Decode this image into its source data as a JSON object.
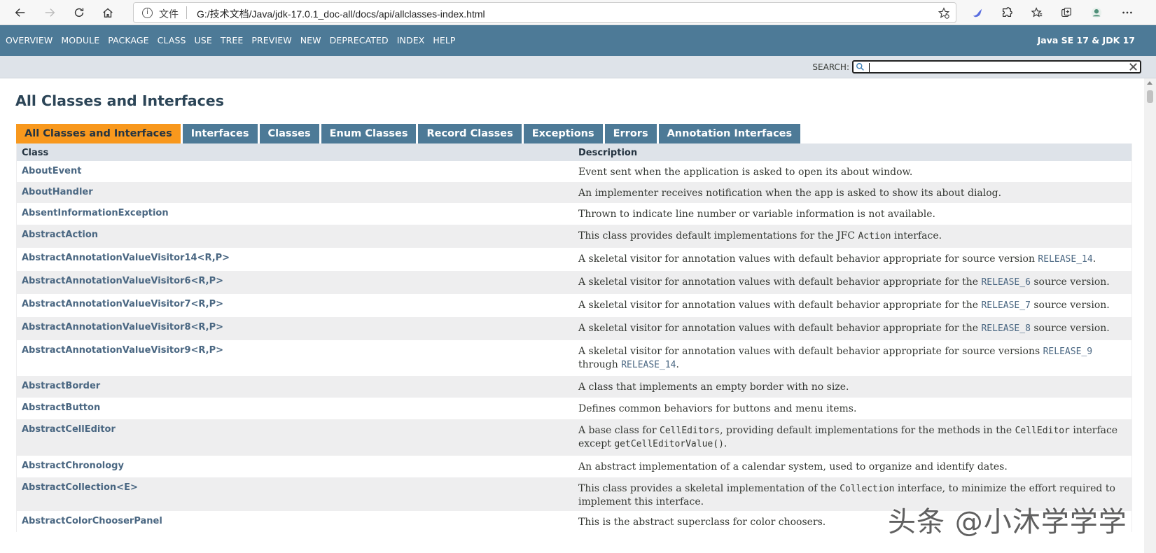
{
  "browser": {
    "address_protocol": "文件",
    "address_url": "G:/技术文档/Java/jdk-17.0.1_doc-all/docs/api/allclasses-index.html"
  },
  "top_nav": {
    "items": [
      "OVERVIEW",
      "MODULE",
      "PACKAGE",
      "CLASS",
      "USE",
      "TREE",
      "PREVIEW",
      "NEW",
      "DEPRECATED",
      "INDEX",
      "HELP"
    ],
    "about": "Java SE 17 & JDK 17"
  },
  "search": {
    "label": "SEARCH:",
    "value": ""
  },
  "page": {
    "title": "All Classes and Interfaces"
  },
  "tabs": [
    {
      "label": "All Classes and Interfaces",
      "active": true
    },
    {
      "label": "Interfaces",
      "active": false
    },
    {
      "label": "Classes",
      "active": false
    },
    {
      "label": "Enum Classes",
      "active": false
    },
    {
      "label": "Record Classes",
      "active": false
    },
    {
      "label": "Exceptions",
      "active": false
    },
    {
      "label": "Errors",
      "active": false
    },
    {
      "label": "Annotation Interfaces",
      "active": false
    }
  ],
  "table": {
    "headers": [
      "Class",
      "Description"
    ],
    "rows": [
      {
        "cls": "AboutEvent",
        "desc": [
          [
            "t",
            "Event sent when the application is asked to open its about window."
          ]
        ]
      },
      {
        "cls": "AboutHandler",
        "desc": [
          [
            "t",
            "An implementer receives notification when the app is asked to show its about dialog."
          ]
        ]
      },
      {
        "cls": "AbsentInformationException",
        "desc": [
          [
            "t",
            "Thrown to indicate line number or variable information is not available."
          ]
        ]
      },
      {
        "cls": "AbstractAction",
        "desc": [
          [
            "t",
            "This class provides default implementations for the JFC "
          ],
          [
            "c",
            "Action"
          ],
          [
            "t",
            " interface."
          ]
        ]
      },
      {
        "cls": "AbstractAnnotationValueVisitor14<R,P>",
        "desc": [
          [
            "t",
            "A skeletal visitor for annotation values with default behavior appropriate for source version "
          ],
          [
            "l",
            "RELEASE_14"
          ],
          [
            "t",
            "."
          ]
        ]
      },
      {
        "cls": "AbstractAnnotationValueVisitor6<R,P>",
        "desc": [
          [
            "t",
            "A skeletal visitor for annotation values with default behavior appropriate for the "
          ],
          [
            "l",
            "RELEASE_6"
          ],
          [
            "t",
            " source version."
          ]
        ]
      },
      {
        "cls": "AbstractAnnotationValueVisitor7<R,P>",
        "desc": [
          [
            "t",
            "A skeletal visitor for annotation values with default behavior appropriate for the "
          ],
          [
            "l",
            "RELEASE_7"
          ],
          [
            "t",
            " source version."
          ]
        ]
      },
      {
        "cls": "AbstractAnnotationValueVisitor8<R,P>",
        "desc": [
          [
            "t",
            "A skeletal visitor for annotation values with default behavior appropriate for the "
          ],
          [
            "l",
            "RELEASE_8"
          ],
          [
            "t",
            " source version."
          ]
        ]
      },
      {
        "cls": "AbstractAnnotationValueVisitor9<R,P>",
        "desc": [
          [
            "t",
            "A skeletal visitor for annotation values with default behavior appropriate for source versions "
          ],
          [
            "l",
            "RELEASE_9"
          ],
          [
            "t",
            " through "
          ],
          [
            "l",
            "RELEASE_14"
          ],
          [
            "t",
            "."
          ]
        ]
      },
      {
        "cls": "AbstractBorder",
        "desc": [
          [
            "t",
            "A class that implements an empty border with no size."
          ]
        ]
      },
      {
        "cls": "AbstractButton",
        "desc": [
          [
            "t",
            "Defines common behaviors for buttons and menu items."
          ]
        ]
      },
      {
        "cls": "AbstractCellEditor",
        "desc": [
          [
            "t",
            "A base class for "
          ],
          [
            "c",
            "CellEditors"
          ],
          [
            "t",
            ", providing default implementations for the methods in the "
          ],
          [
            "c",
            "CellEditor"
          ],
          [
            "t",
            " interface except "
          ],
          [
            "c",
            "getCellEditorValue()"
          ],
          [
            "t",
            "."
          ]
        ]
      },
      {
        "cls": "AbstractChronology",
        "desc": [
          [
            "t",
            "An abstract implementation of a calendar system, used to organize and identify dates."
          ]
        ]
      },
      {
        "cls": "AbstractCollection<E>",
        "desc": [
          [
            "t",
            "This class provides a skeletal implementation of the "
          ],
          [
            "c",
            "Collection"
          ],
          [
            "t",
            " interface, to minimize the effort required to implement this interface."
          ]
        ]
      },
      {
        "cls": "AbstractColorChooserPanel",
        "desc": [
          [
            "t",
            "This is the abstract superclass for color choosers."
          ]
        ]
      }
    ]
  },
  "watermark": "头条 @小沐学学学"
}
